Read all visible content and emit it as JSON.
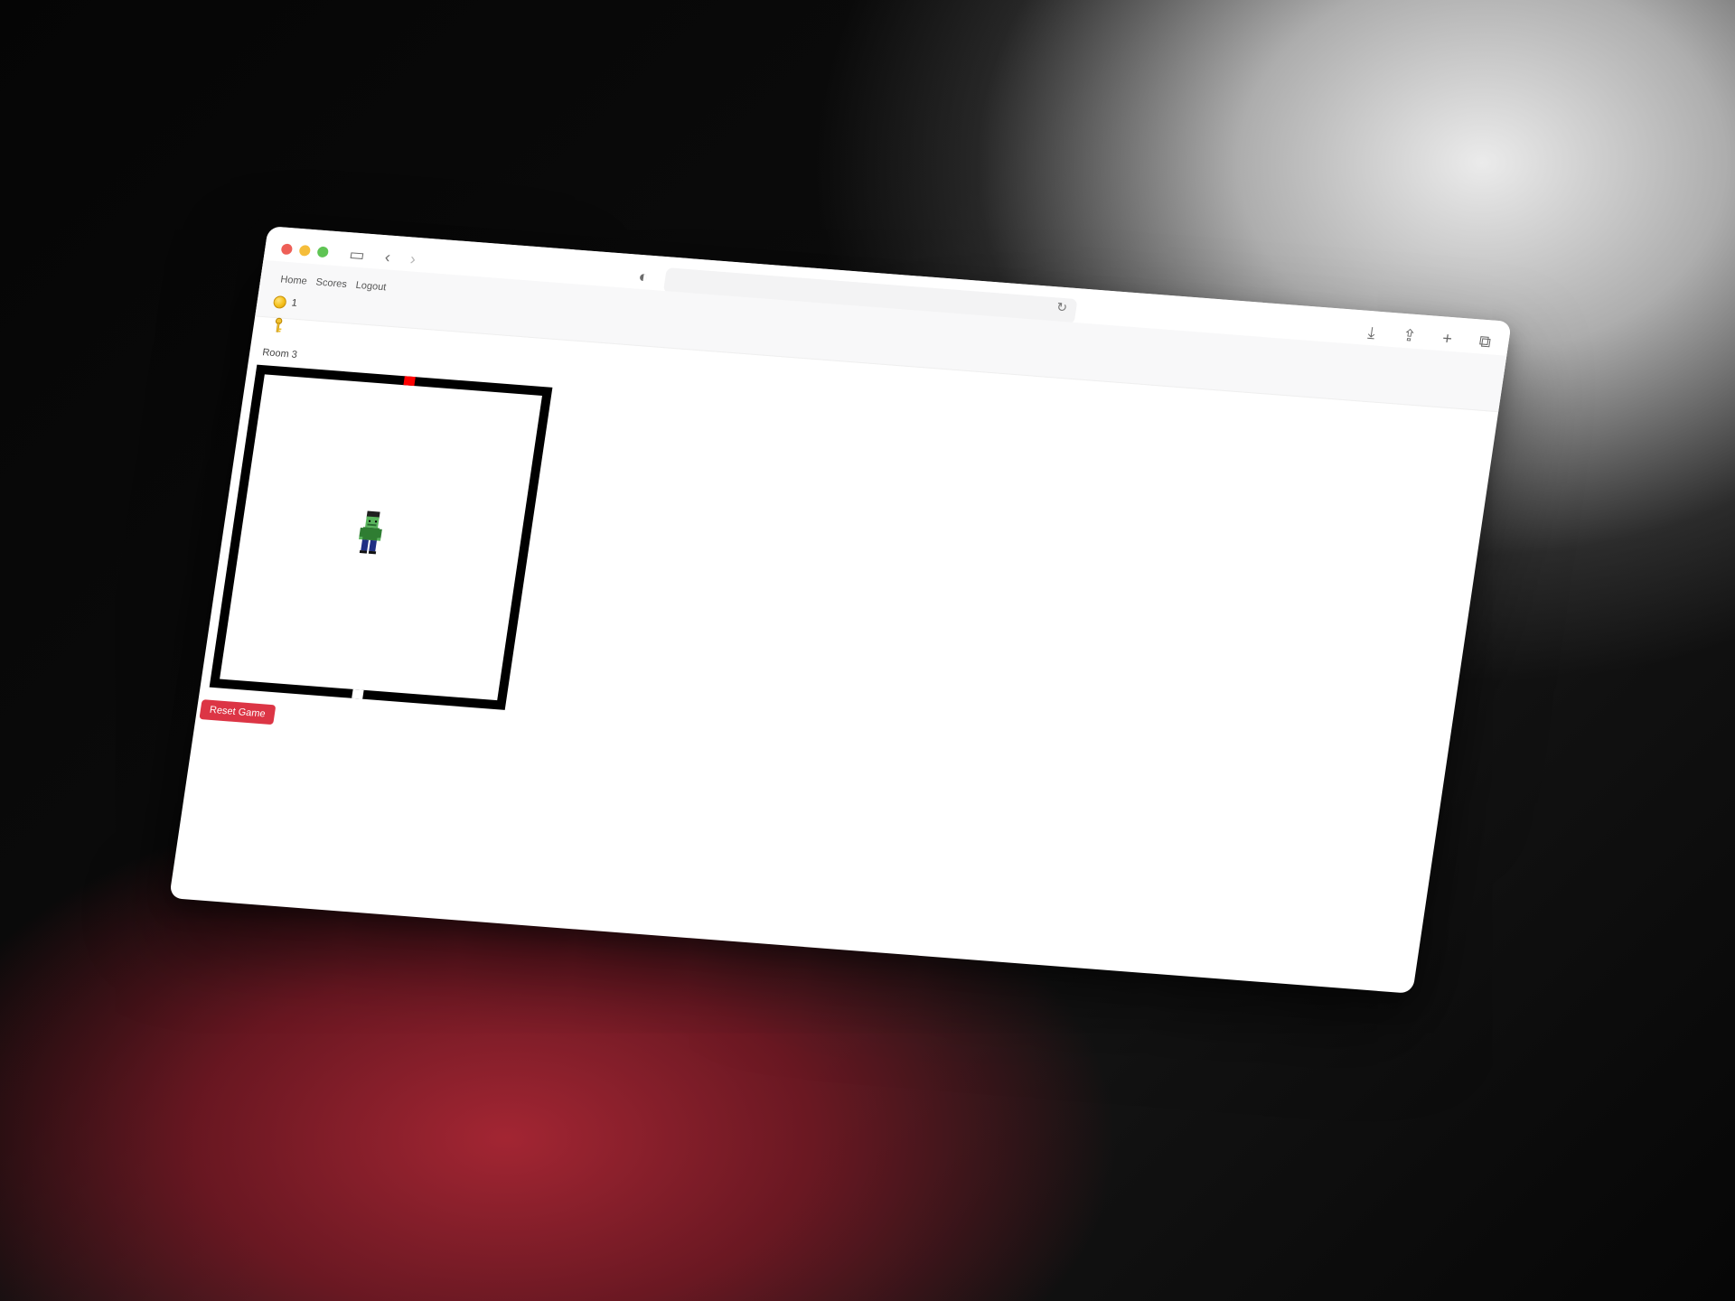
{
  "browser": {
    "address": "",
    "traffic_lights": {
      "close": "#ee5f57",
      "minimize": "#f5bd3a",
      "zoom": "#5fc454"
    },
    "icons": {
      "sidebar": "sidebar-icon",
      "back": "chevron-left-icon",
      "forward": "chevron-right-icon",
      "shield": "shield-icon",
      "reload": "reload-icon",
      "download": "download-icon",
      "share": "share-icon",
      "new_tab": "plus-icon",
      "tabs": "tabs-icon"
    }
  },
  "nav": {
    "items": [
      {
        "label": "Home"
      },
      {
        "label": "Scores"
      },
      {
        "label": "Logout"
      }
    ]
  },
  "inventory": {
    "coins": "1",
    "coin_icon": "coin-icon",
    "key_icon": "key-icon"
  },
  "game": {
    "room_label": "Room 3",
    "reset_label": "Reset Game",
    "reset_color": "#dc3545",
    "top_door_color": "#ff0000",
    "wall_color": "#000000"
  }
}
